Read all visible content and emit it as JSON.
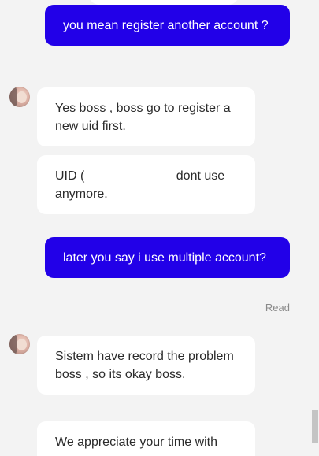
{
  "messages": [
    {
      "direction": "out",
      "text": "you mean register another account ?"
    },
    {
      "direction": "in",
      "text": "Yes boss , boss go to register a new uid first."
    },
    {
      "direction": "in",
      "text_before": "UID (",
      "text_after": " dont use anymore."
    },
    {
      "direction": "out",
      "text": "later you say i use multiple account?"
    },
    {
      "direction": "in",
      "text": "Sistem have record the problem boss , so its okay boss."
    },
    {
      "direction": "in",
      "text": "We appreciate your time with"
    }
  ],
  "read_status": "Read",
  "colors": {
    "outgoing_bubble": "#2200e8",
    "incoming_bubble": "#ffffff",
    "background": "#f3f3f3"
  }
}
